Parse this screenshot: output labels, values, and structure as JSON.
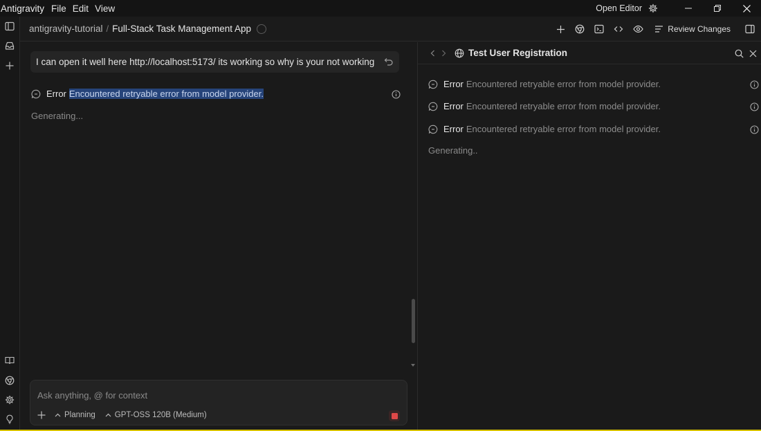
{
  "titlebar": {
    "app_name": "Antigravity",
    "menus": [
      "File",
      "Edit",
      "View"
    ],
    "open_editor": "Open Editor"
  },
  "header": {
    "breadcrumb": [
      "antigravity-tutorial",
      "Full-Stack Task Management App"
    ],
    "separator": "/",
    "review_changes": "Review Changes"
  },
  "chat": {
    "user_message": "I can open it well here http://localhost:5173/ its working so why is your not working",
    "error_label": "Error",
    "error_text": "Encountered retryable error from model provider.",
    "generating": "Generating..."
  },
  "composer": {
    "placeholder": "Ask anything, @ for context",
    "mode": "Planning",
    "model": "GPT-OSS 120B (Medium)"
  },
  "right_panel": {
    "title": "Test User Registration",
    "errors": [
      {
        "label": "Error",
        "text": "Encountered retryable error from model provider."
      },
      {
        "label": "Error",
        "text": "Encountered retryable error from model provider."
      },
      {
        "label": "Error",
        "text": "Encountered retryable error from model provider."
      }
    ],
    "generating": "Generating.."
  },
  "colors": {
    "background": "#1a1a1a",
    "selection": "#26447a",
    "stop": "#e24848",
    "bottom_accent": "#d6c000"
  }
}
